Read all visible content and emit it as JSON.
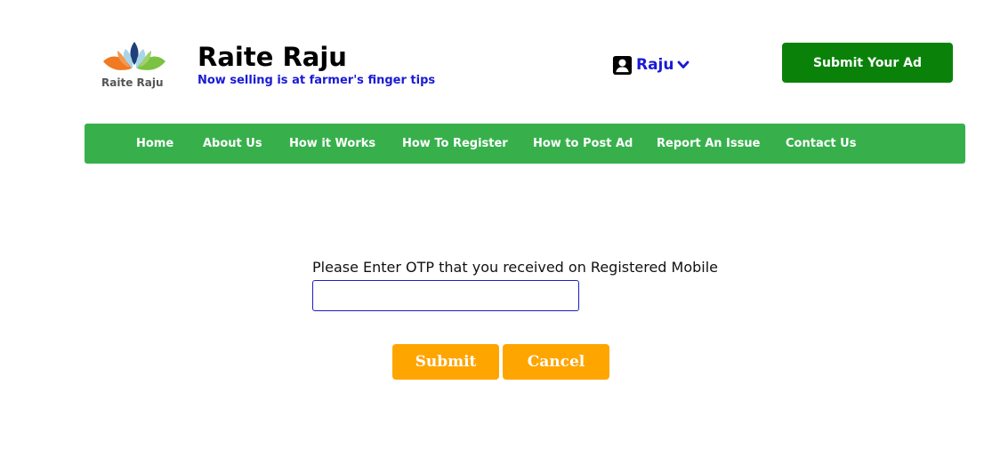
{
  "header": {
    "logo_text": "Raite Raju",
    "title": "Raite Raju",
    "tagline": "Now selling is at farmer's finger tips",
    "user": {
      "name": "Raju",
      "icon": "user-account-icon",
      "dropdown_icon": "chevron-down-icon"
    },
    "submit_ad_label": "Submit Your Ad"
  },
  "nav": {
    "items": [
      {
        "label": "Home"
      },
      {
        "label": "About Us"
      },
      {
        "label": "How it Works"
      },
      {
        "label": "How To Register"
      },
      {
        "label": "How to Post Ad"
      },
      {
        "label": "Report An Issue"
      },
      {
        "label": "Contact Us"
      }
    ]
  },
  "otp_form": {
    "label": "Please Enter OTP that you received on Registered Mobile",
    "input_value": "",
    "submit_label": "Submit",
    "cancel_label": "Cancel"
  },
  "colors": {
    "brand_green": "#0a820a",
    "nav_green": "#37b04c",
    "link_blue": "#1a1ad6",
    "button_orange": "#ffa500"
  }
}
